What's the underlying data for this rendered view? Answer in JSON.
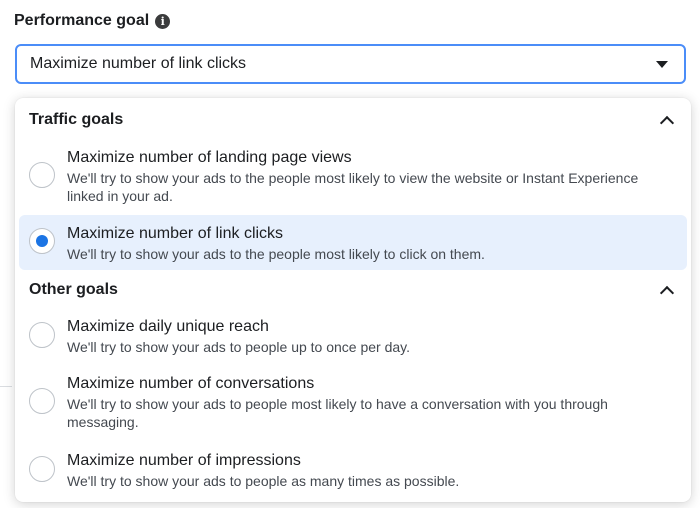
{
  "performance_goal": {
    "label": "Performance goal",
    "info_glyph": "i",
    "selected_value": "Maximize number of link clicks"
  },
  "dropdown": {
    "sections": [
      {
        "title": "Traffic goals",
        "options": [
          {
            "title": "Maximize number of landing page views",
            "description": "We'll try to show your ads to the people most likely to view the website or Instant Experience linked in your ad.",
            "selected": false
          },
          {
            "title": "Maximize number of link clicks",
            "description": "We'll try to show your ads to the people most likely to click on them.",
            "selected": true
          }
        ]
      },
      {
        "title": "Other goals",
        "options": [
          {
            "title": "Maximize daily unique reach",
            "description": "We'll try to show your ads to people up to once per day.",
            "selected": false
          },
          {
            "title": "Maximize number of conversations",
            "description": "We'll try to show your ads to people most likely to have a conversation with you through messaging.",
            "selected": false
          },
          {
            "title": "Maximize number of impressions",
            "description": "We'll try to show your ads to people as many times as possible.",
            "selected": false
          }
        ]
      }
    ]
  },
  "colors": {
    "focus_border": "#4b8df8",
    "selected_bg": "#e7f0fd",
    "radio_selected": "#1b74e4"
  },
  "icons": {
    "info": "info-icon",
    "dropdown_caret": "caret-down-icon",
    "section_collapse": "chevron-up-icon"
  }
}
